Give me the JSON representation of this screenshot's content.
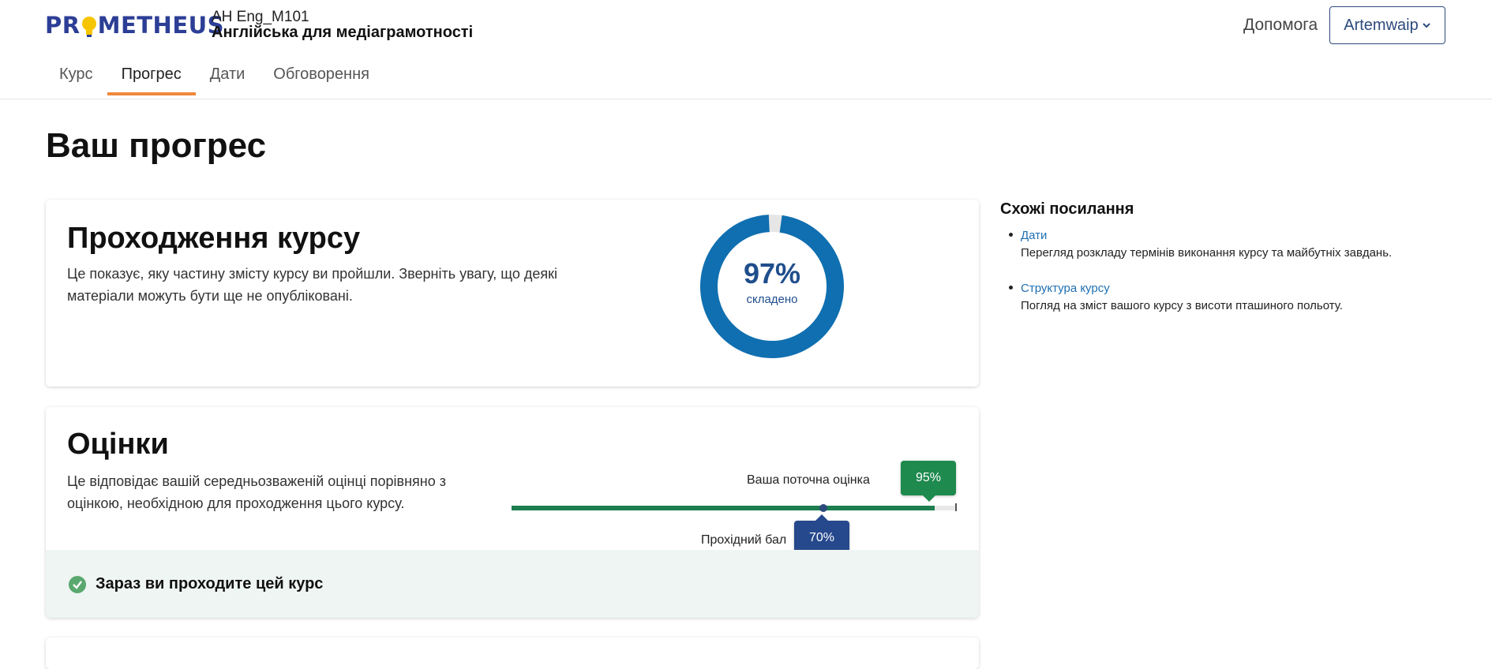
{
  "header": {
    "logo_text": "PROMETHEUS",
    "course_code": "AH Eng_M101",
    "course_title": "Англійська для медіаграмотності",
    "help_label": "Допомога",
    "user_label": "Artemwaip",
    "tabs": [
      {
        "label": "Курс"
      },
      {
        "label": "Прогрес"
      },
      {
        "label": "Дати"
      },
      {
        "label": "Обговорення"
      }
    ],
    "active_tab": "Прогрес"
  },
  "page_title": "Ваш прогрес",
  "completion": {
    "title": "Проходження курсу",
    "description": "Це показує, яку частину змісту курсу ви пройшли. Зверніть увагу, що деякі матеріали можуть бути ще не опубліковані.",
    "percent": 97,
    "percent_label": "97%",
    "sub_label": "складено"
  },
  "grades": {
    "title": "Оцінки",
    "description": "Це відповідає вашій середньозваженій оцінці порівняно з оцінкою, необхідною для проходження цього курсу.",
    "current_label": "Ваша поточна оцінка",
    "current_value": "95%",
    "current_fraction": 0.95,
    "passing_label": "Прохідний бал",
    "passing_value": "70%",
    "passing_fraction": 0.7,
    "status_text": "Зараз ви проходите цей курс"
  },
  "related": {
    "title": "Схожі посилання",
    "items": [
      {
        "label": "Дати",
        "description": "Перегляд розкладу термінів виконання курсу та майбутніх завдань."
      },
      {
        "label": "Структура курсу",
        "description": "Погляд на зміст вашого курсу з висоти пташиного польоту."
      }
    ]
  },
  "colors": {
    "brand": "#2c3e95",
    "accent": "#f0883a",
    "donut_fill": "#0f6fb0",
    "grade_bar": "#1e7e50",
    "passing": "#26488c"
  }
}
